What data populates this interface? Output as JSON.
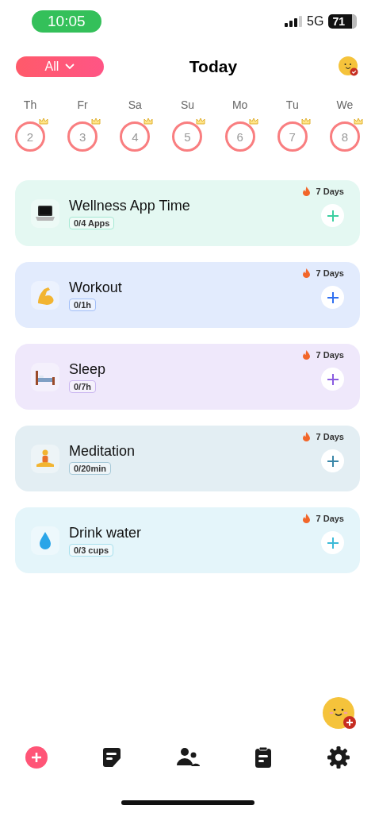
{
  "status_bar": {
    "time": "10:05",
    "network": "5G",
    "battery": "71"
  },
  "header": {
    "filter": "All",
    "title": "Today"
  },
  "days": [
    {
      "weekday": "Th",
      "date": "2"
    },
    {
      "weekday": "Fr",
      "date": "3"
    },
    {
      "weekday": "Sa",
      "date": "4"
    },
    {
      "weekday": "Su",
      "date": "5"
    },
    {
      "weekday": "Mo",
      "date": "6"
    },
    {
      "weekday": "Tu",
      "date": "7"
    },
    {
      "weekday": "We",
      "date": "8"
    }
  ],
  "habits": [
    {
      "kind": "laptop",
      "title": "Wellness App Time",
      "progress": "0/4 Apps",
      "streak": "7 Days",
      "color": "#3ccfa0"
    },
    {
      "kind": "arm",
      "title": "Workout",
      "progress": "0/1h",
      "streak": "7 Days",
      "color": "#2f6ff0"
    },
    {
      "kind": "bed",
      "title": "Sleep",
      "progress": "0/7h",
      "streak": "7 Days",
      "color": "#8a5ce0"
    },
    {
      "kind": "meditation",
      "title": "Meditation",
      "progress": "0/20min",
      "streak": "7 Days",
      "color": "#3a86a8"
    },
    {
      "kind": "water",
      "title": "Drink water",
      "progress": "0/3 cups",
      "streak": "7 Days",
      "color": "#3cbad8"
    }
  ],
  "tab_bar": [
    {
      "kind": "add",
      "selected": true
    },
    {
      "kind": "notes",
      "selected": false
    },
    {
      "kind": "people",
      "selected": false
    },
    {
      "kind": "clipboard",
      "selected": false
    },
    {
      "kind": "settings",
      "selected": false
    }
  ]
}
